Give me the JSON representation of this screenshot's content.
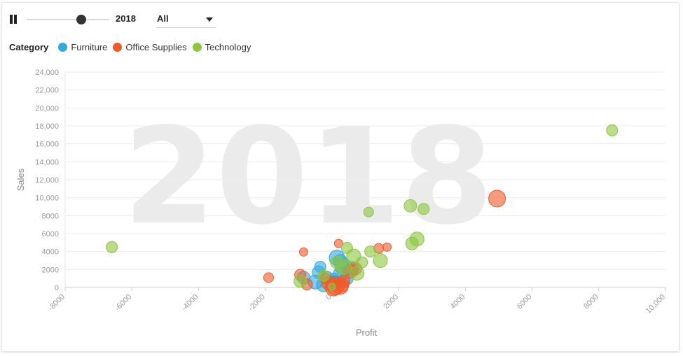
{
  "controls": {
    "year": "2018",
    "slider_value": 0.66,
    "filter_selected": "All"
  },
  "legend": {
    "title": "Category",
    "items": [
      {
        "label": "Furniture",
        "color": "#33a8e0"
      },
      {
        "label": "Office Supplies",
        "color": "#f05a28"
      },
      {
        "label": "Technology",
        "color": "#8cc63f"
      }
    ]
  },
  "chart_data": {
    "type": "scatter",
    "watermark": "2018",
    "xlabel": "Profit",
    "ylabel": "Sales",
    "xlim": [
      -8000,
      10000
    ],
    "ylim": [
      0,
      24000
    ],
    "xticks": [
      "-8000",
      "-6000",
      "-4000",
      "-2000",
      "0",
      "2000",
      "4000",
      "6000",
      "8000",
      "10,000"
    ],
    "xtick_values": [
      -8000,
      -6000,
      -4000,
      -2000,
      0,
      2000,
      4000,
      6000,
      8000,
      10000
    ],
    "yticks": [
      "0",
      "2000",
      "4000",
      "6000",
      "8000",
      "10,000",
      "12,000",
      "14,000",
      "16,000",
      "18,000",
      "20,000",
      "22,000",
      "24,000"
    ],
    "ytick_values": [
      0,
      2000,
      4000,
      6000,
      8000,
      10000,
      12000,
      14000,
      16000,
      18000,
      20000,
      22000,
      24000
    ],
    "grid": "horizontal",
    "series": [
      {
        "name": "Furniture",
        "color": "#33a8e0",
        "points": [
          {
            "x": 150,
            "y": 3300,
            "r": 11
          },
          {
            "x": 250,
            "y": 2900,
            "r": 10
          },
          {
            "x": 350,
            "y": 2300,
            "r": 12
          },
          {
            "x": 600,
            "y": 2100,
            "r": 10
          },
          {
            "x": -350,
            "y": 2300,
            "r": 8
          },
          {
            "x": -400,
            "y": 1700,
            "r": 9
          },
          {
            "x": -850,
            "y": 1100,
            "r": 9
          },
          {
            "x": -150,
            "y": 1200,
            "r": 8
          },
          {
            "x": 50,
            "y": 900,
            "r": 9
          },
          {
            "x": -500,
            "y": 600,
            "r": 10
          },
          {
            "x": 250,
            "y": 1500,
            "r": 10
          },
          {
            "x": 100,
            "y": 600,
            "r": 9
          },
          {
            "x": -250,
            "y": 300,
            "r": 10
          },
          {
            "x": 450,
            "y": 1000,
            "r": 9
          }
        ]
      },
      {
        "name": "Office Supplies",
        "color": "#f05a28",
        "points": [
          {
            "x": 4950,
            "y": 9900,
            "r": 12
          },
          {
            "x": 1650,
            "y": 4500,
            "r": 6
          },
          {
            "x": 1400,
            "y": 4350,
            "r": 7
          },
          {
            "x": -850,
            "y": 3950,
            "r": 6
          },
          {
            "x": 200,
            "y": 4900,
            "r": 6
          },
          {
            "x": -1900,
            "y": 1100,
            "r": 7
          },
          {
            "x": -950,
            "y": 1400,
            "r": 8
          },
          {
            "x": -750,
            "y": 350,
            "r": 8
          },
          {
            "x": 700,
            "y": 2100,
            "r": 9
          },
          {
            "x": 550,
            "y": 1800,
            "r": 10
          },
          {
            "x": 350,
            "y": 700,
            "r": 9
          },
          {
            "x": -100,
            "y": 500,
            "r": 10
          },
          {
            "x": 100,
            "y": 200,
            "r": 13
          },
          {
            "x": 50,
            "y": 0,
            "r": 12
          },
          {
            "x": 250,
            "y": 100,
            "r": 11
          },
          {
            "x": -200,
            "y": 1000,
            "r": 8
          },
          {
            "x": 300,
            "y": 300,
            "r": 10
          }
        ]
      },
      {
        "name": "Technology",
        "color": "#8cc63f",
        "points": [
          {
            "x": 8400,
            "y": 17500,
            "r": 8
          },
          {
            "x": -6600,
            "y": 4500,
            "r": 8
          },
          {
            "x": 1100,
            "y": 8400,
            "r": 7
          },
          {
            "x": 2350,
            "y": 9100,
            "r": 9
          },
          {
            "x": 2750,
            "y": 8750,
            "r": 8
          },
          {
            "x": 2550,
            "y": 5400,
            "r": 10
          },
          {
            "x": 2400,
            "y": 4900,
            "r": 9
          },
          {
            "x": 1450,
            "y": 3000,
            "r": 10
          },
          {
            "x": 1150,
            "y": 4000,
            "r": 8
          },
          {
            "x": 450,
            "y": 4400,
            "r": 8
          },
          {
            "x": 650,
            "y": 3500,
            "r": 10
          },
          {
            "x": 900,
            "y": 2800,
            "r": 8
          },
          {
            "x": 750,
            "y": 1600,
            "r": 10
          },
          {
            "x": 350,
            "y": 2300,
            "r": 11
          },
          {
            "x": 150,
            "y": 2800,
            "r": 9
          },
          {
            "x": -250,
            "y": 1300,
            "r": 8
          },
          {
            "x": -950,
            "y": 700,
            "r": 9
          },
          {
            "x": 0,
            "y": 100,
            "r": 5
          }
        ]
      }
    ]
  }
}
